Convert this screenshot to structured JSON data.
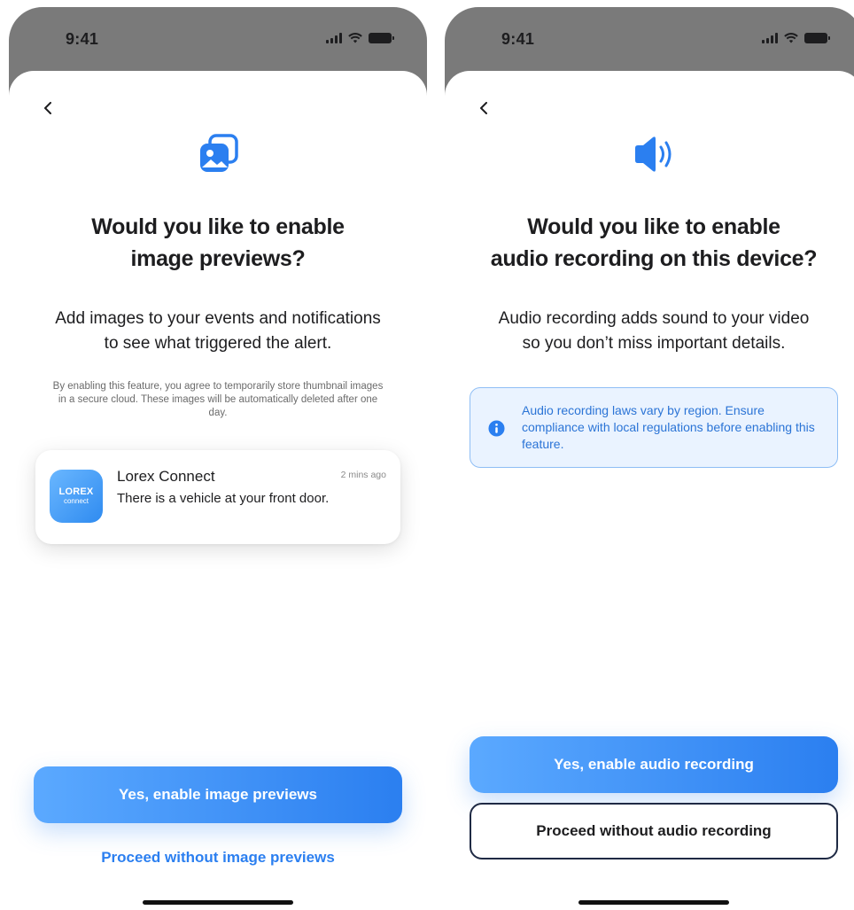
{
  "screens": [
    {
      "status": {
        "time": "9:41"
      },
      "icon": "image-gallery-icon",
      "title": "Would you like to enable\nimage previews?",
      "body": "Add images to your events and notifications\nto see what triggered the alert.",
      "fine_print": "By enabling this feature, you agree to temporarily store thumbnail images in a secure cloud. These images will be automatically deleted after one day.",
      "notification": {
        "app_brand": "LOREX",
        "app_sub": "connect",
        "title": "Lorex Connect",
        "time": "2 mins ago",
        "body": "There is a vehicle at your front door."
      },
      "primary_button": "Yes, enable image previews",
      "secondary_link": "Proceed without image previews"
    },
    {
      "status": {
        "time": "9:41"
      },
      "icon": "speaker-icon",
      "title": "Would you like to enable\naudio recording on this device?",
      "body": "Audio recording adds sound to your video\nso you don’t miss important details.",
      "info": "Audio recording laws vary by region. Ensure compliance with local regulations before enabling this feature.",
      "primary_button": "Yes, enable audio recording",
      "secondary_button": "Proceed without audio recording"
    }
  ],
  "colors": {
    "accent": "#2B7FF0",
    "accent_light": "#5BA9FF",
    "info_background": "#EAF3FF",
    "info_border": "#8FBEF5",
    "outline_border": "#1F2A44",
    "status_bar": "#7A7A7A"
  }
}
